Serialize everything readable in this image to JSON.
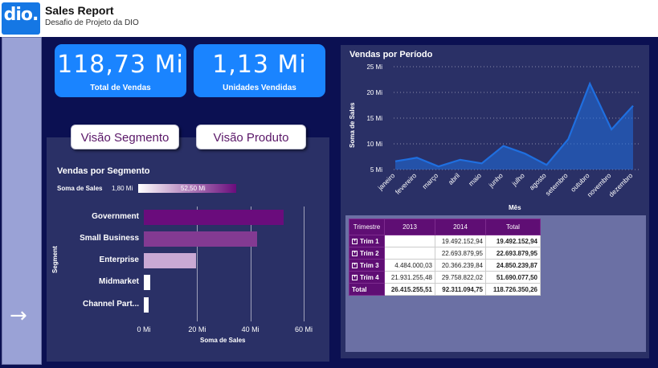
{
  "header": {
    "logo_text": "dio.",
    "title": "Sales Report",
    "subtitle": "Desafio de Projeto da DIO"
  },
  "nav": {
    "arrow_icon": "arrow-right-icon",
    "arrow_glyph": "→"
  },
  "kpis": {
    "total_vendas": {
      "value": "118,73 Mi",
      "label": "Total de Vendas"
    },
    "unidades": {
      "value": "1,13 Mi",
      "label": "Unidades Vendidas"
    }
  },
  "buttons": {
    "segmento": "Visão Segmento",
    "produto": "Visão Produto"
  },
  "segment_chart": {
    "title": "Vendas por Segmento",
    "legend_label": "Soma de  Sales",
    "legend_min": "1,80 Mi",
    "legend_max": "52,50 Mi",
    "ylabel": "Segment",
    "xlabel": "Soma de Sales",
    "x_ticks": [
      "0 Mi",
      "20 Mi",
      "40 Mi",
      "60 Mi"
    ]
  },
  "line_chart": {
    "title": "Vendas por Período",
    "ylabel": "Soma de Sales",
    "xlabel": "Mês",
    "y_ticks": [
      "25 Mi",
      "20 Mi",
      "15 Mi",
      "10 Mi",
      "5 Mi"
    ]
  },
  "chart_data": [
    {
      "type": "bar",
      "title": "Vendas por Segmento",
      "categories": [
        "Government",
        "Small Business",
        "Enterprise",
        "Midmarket",
        "Channel Part..."
      ],
      "values": [
        52.5,
        42.4,
        19.6,
        2.4,
        1.8
      ],
      "xlabel": "Soma de Sales",
      "ylabel": "Segment",
      "xlim": [
        0,
        60
      ],
      "colors": [
        "#6a0c7c",
        "#833a92",
        "#c9a9d4",
        "#ffffff",
        "#ffffff"
      ]
    },
    {
      "type": "area",
      "title": "Vendas por Período",
      "categories": [
        "janeiro",
        "fevereiro",
        "março",
        "abril",
        "maio",
        "junho",
        "julho",
        "agosto",
        "setembro",
        "outubro",
        "novembro",
        "dezembro"
      ],
      "values": [
        6.6,
        7.3,
        5.6,
        6.9,
        6.2,
        9.6,
        8.1,
        5.9,
        10.9,
        21.7,
        12.8,
        17.4
      ],
      "xlabel": "Mês",
      "ylabel": "Soma de Sales",
      "ylim": [
        5,
        25
      ],
      "color": "#1f6fe0"
    }
  ],
  "matrix": {
    "headers": [
      "Trimestre",
      "2013",
      "2014",
      "Total"
    ],
    "rows": [
      {
        "label": "Trim 1",
        "c2013": "",
        "c2014": "19.492.152,94",
        "total": "19.492.152,94"
      },
      {
        "label": "Trim 2",
        "c2013": "",
        "c2014": "22.693.879,95",
        "total": "22.693.879,95"
      },
      {
        "label": "Trim 3",
        "c2013": "4.484.000,03",
        "c2014": "20.366.239,84",
        "total": "24.850.239,87"
      },
      {
        "label": "Trim 4",
        "c2013": "21.931.255,48",
        "c2014": "29.758.822,02",
        "total": "51.690.077,50"
      }
    ],
    "grand": {
      "label": "Total",
      "c2013": "26.415.255,51",
      "c2014": "92.311.094,75",
      "total": "118.726.350,26"
    },
    "expand_glyph": "+"
  }
}
